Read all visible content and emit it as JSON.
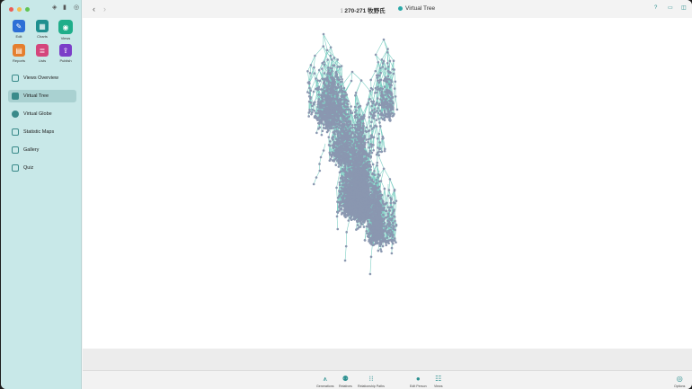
{
  "window": {
    "title_tree_glyph": "⟟",
    "title": "270-271 牧野氏",
    "subtitle": "Virtual Tree"
  },
  "sidebar": {
    "modules": [
      {
        "label": "Edit",
        "color": "#2d6fd6",
        "icon": "pencil-icon"
      },
      {
        "label": "Charts",
        "color": "#1f8f8f",
        "icon": "charts-icon"
      },
      {
        "label": "Views",
        "color": "#1fae8a",
        "icon": "eye-icon"
      },
      {
        "label": "Reports",
        "color": "#e57f2e",
        "icon": "report-icon"
      },
      {
        "label": "Lists",
        "color": "#d4467c",
        "icon": "list-icon"
      },
      {
        "label": "Publish",
        "color": "#7b3fc8",
        "icon": "publish-icon"
      }
    ],
    "nav": [
      {
        "label": "Views Overview",
        "icon": "grid-icon"
      },
      {
        "label": "Virtual Tree",
        "icon": "cube-icon",
        "active": true
      },
      {
        "label": "Virtual Globe",
        "icon": "globe-icon"
      },
      {
        "label": "Statistic Maps",
        "icon": "map-icon"
      },
      {
        "label": "Gallery",
        "icon": "gallery-icon"
      },
      {
        "label": "Quiz",
        "icon": "quiz-icon"
      }
    ]
  },
  "toolbar": {
    "generations": "Generations",
    "relatives": "Relatives",
    "relationship_paths": "Relationship Paths",
    "edit_person": "Edit Person",
    "views": "Views",
    "options": "Options"
  },
  "colors": {
    "accent": "#2a8f8f",
    "node": "#8a97b0",
    "edge": "#7fcfc4"
  }
}
